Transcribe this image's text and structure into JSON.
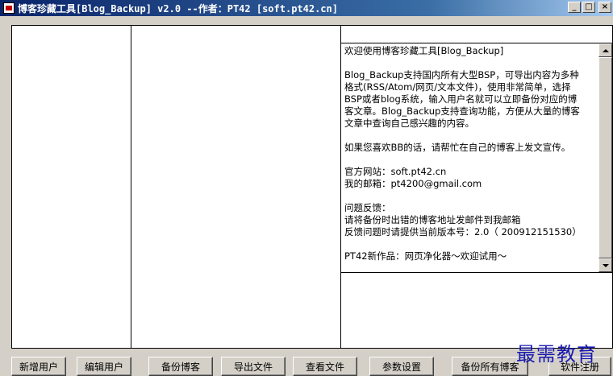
{
  "window": {
    "title": "博客珍藏工具[Blog_Backup] v2.0 --作者：PT42 [soft.pt42.cn]",
    "controls": {
      "minimize": "_",
      "maximize": "□",
      "close": "×"
    }
  },
  "info_text": {
    "lines": [
      "欢迎使用博客珍藏工具[Blog_Backup]",
      "Blog_Backup支持国内所有大型BSP，可导出内容为多种",
      "格式(RSS/Atom/网页/文本文件)，使用非常简单，选择",
      "BSP或者blog系统，输入用户名就可以立即备份对应的博",
      "客文章。Blog_Backup支持查询功能，方便从大量的博客",
      "文章中查询自己感兴趣的内容。",
      "如果您喜欢BB的话，请帮忙在自己的博客上发文宣传。",
      "官方网站：soft.pt42.cn",
      "我的邮箱：pt4200@gmail.com",
      "问题反馈：",
      "请将备份时出错的博客地址发邮件到我邮箱",
      "反馈问题时请提供当前版本号：2.0（ 200912151530）",
      "PT42新作品：网页净化器～欢迎试用～"
    ]
  },
  "buttons": {
    "add_user": "新增用户",
    "edit_user": "编辑用户",
    "backup_blog": "备份博客",
    "export_file": "导出文件",
    "view_file": "查看文件",
    "settings": "参数设置",
    "backup_all": "备份所有博客",
    "register": "软件注册"
  },
  "watermark": "最需教育",
  "colors": {
    "titlebar_start": "#0a246a",
    "titlebar_end": "#a6caf0",
    "face": "#d4d0c8",
    "watermark": "#1a1ab0"
  }
}
